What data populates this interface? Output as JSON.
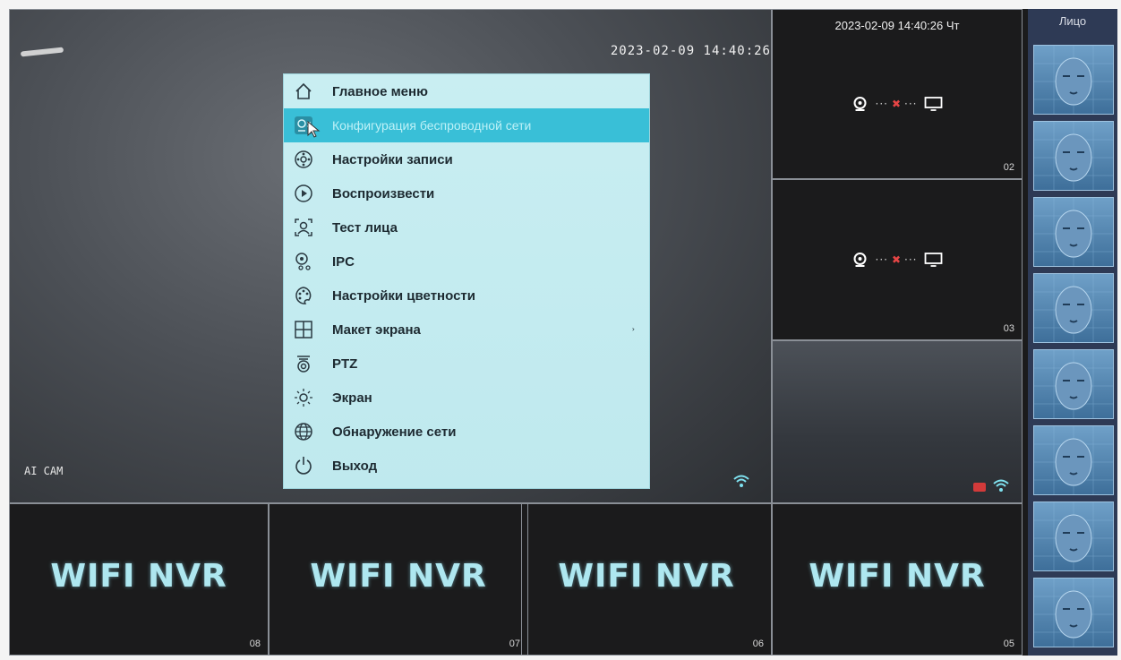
{
  "main_camera": {
    "timestamp": "2023-02-09 14:40:26",
    "label": "AI CAM"
  },
  "menu": {
    "items": [
      {
        "label": "Главное меню",
        "icon": "home-icon"
      },
      {
        "label": "Конфигурация беспроводной сети",
        "icon": "wireless-config-icon",
        "active": true
      },
      {
        "label": "Настройки записи",
        "icon": "record-settings-icon"
      },
      {
        "label": "Воспроизвести",
        "icon": "play-icon"
      },
      {
        "label": "Тест лица",
        "icon": "face-test-icon"
      },
      {
        "label": "IPC",
        "icon": "ipc-icon"
      },
      {
        "label": "Настройки цветности",
        "icon": "palette-icon"
      },
      {
        "label": "Макет экрана",
        "icon": "layout-icon",
        "submenu": "›"
      },
      {
        "label": "PTZ",
        "icon": "ptz-camera-icon"
      },
      {
        "label": "Экран",
        "icon": "brightness-icon"
      },
      {
        "label": "Обнаружение сети",
        "icon": "globe-icon"
      },
      {
        "label": "Выход",
        "icon": "power-icon"
      }
    ]
  },
  "right_panel": {
    "timestamp": "2023-02-09 14:40:26 Чт",
    "cam02_number": "02",
    "cam03_number": "03"
  },
  "bottom_channels": [
    {
      "title": "WIFI NVR",
      "number": "08"
    },
    {
      "title": "WIFI NVR",
      "number": "07"
    },
    {
      "title": "WIFI NVR",
      "number": "06"
    },
    {
      "title": "WIFI NVR",
      "number": "05"
    }
  ],
  "faces_panel": {
    "title": "Лицо"
  },
  "colors": {
    "menu_bg": "#c9eef2",
    "menu_active": "#39bfd7",
    "nvr_text": "#aee7f0",
    "wifi": "#7fe2f0"
  }
}
